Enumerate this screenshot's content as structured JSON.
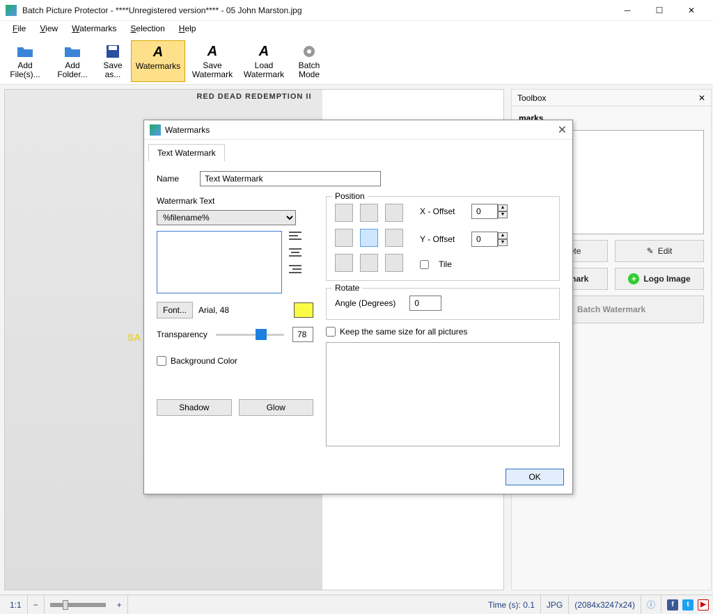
{
  "window": {
    "title": "Batch Picture Protector - ****Unregistered version**** - 05 John Marston.jpg"
  },
  "menu": {
    "file": "File",
    "view": "View",
    "watermarks": "Watermarks",
    "selection": "Selection",
    "help": "Help"
  },
  "toolbar": {
    "add_files": "Add\nFile(s)...",
    "add_folder": "Add\nFolder...",
    "save_as": "Save\nas...",
    "watermarks": "Watermarks",
    "save_wm": "Save\nWatermark",
    "load_wm": "Load\nWatermark",
    "batch": "Batch\nMode"
  },
  "canvas": {
    "logo_text": "RED DEAD REDEMPTION II",
    "sample_text": "SA"
  },
  "toolbox": {
    "title": "Toolbox",
    "section": "marks",
    "item": "ark",
    "delete": "Delete",
    "edit": "Edit",
    "text_wm": "atermark",
    "logo_img": "Logo Image",
    "batch": "Batch Watermark"
  },
  "dialog": {
    "title": "Watermarks",
    "tab": "Text Watermark",
    "name_label": "Name",
    "name_value": "Text Watermark",
    "wm_text_label": "Watermark Text",
    "preset": "%filename%",
    "textarea_value": "",
    "font_btn": "Font...",
    "font_desc": "Arial, 48",
    "transparency_label": "Transparency",
    "transparency_value": "78",
    "bgcolor": "Background Color",
    "shadow": "Shadow",
    "glow": "Glow",
    "position_label": "Position",
    "x_offset": "X - Offset",
    "y_offset": "Y - Offset",
    "x_val": "0",
    "y_val": "0",
    "tile": "Tile",
    "rotate_label": "Rotate",
    "angle_label": "Angle (Degrees)",
    "angle_value": "0",
    "same_size": "Keep the same size for all pictures",
    "ok": "OK"
  },
  "status": {
    "zoom": "1:1",
    "time": "Time (s): 0.1",
    "format": "JPG",
    "dims": "(2084x3247x24)"
  }
}
